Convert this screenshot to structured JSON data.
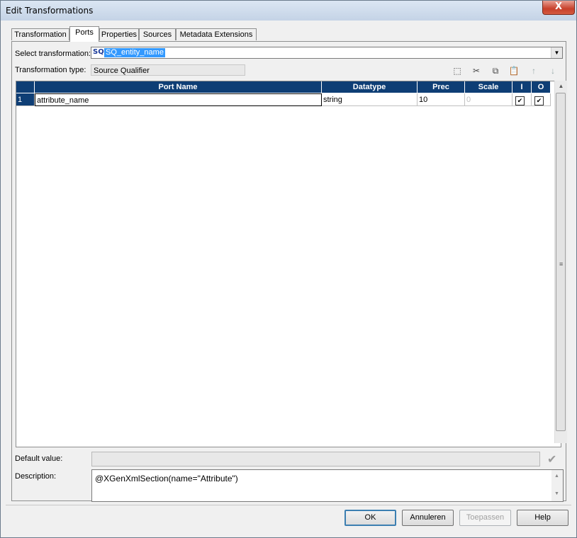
{
  "window": {
    "title": "Edit Transformations",
    "close_glyph": "X"
  },
  "tabs": [
    {
      "label": "Transformation",
      "active": false
    },
    {
      "label": "Ports",
      "active": true
    },
    {
      "label": "Properties",
      "active": false
    },
    {
      "label": "Sources",
      "active": false
    },
    {
      "label": "Metadata Extensions",
      "active": false
    }
  ],
  "select_transformation": {
    "label": "Select transformation:",
    "icon": "SQ",
    "value": "SQ_entity_name"
  },
  "transformation_type": {
    "label": "Transformation type:",
    "value": "Source Qualifier"
  },
  "toolbar": [
    {
      "name": "new-port-icon",
      "glyph": "⬚",
      "enabled": true
    },
    {
      "name": "cut-icon",
      "glyph": "✂",
      "enabled": true
    },
    {
      "name": "copy-icon",
      "glyph": "⧉",
      "enabled": true
    },
    {
      "name": "paste-icon",
      "glyph": "📋",
      "enabled": false
    },
    {
      "name": "move-up-icon",
      "glyph": "↑",
      "enabled": false
    },
    {
      "name": "move-down-icon",
      "glyph": "↓",
      "enabled": false
    }
  ],
  "grid": {
    "columns": [
      "Port Name",
      "Datatype",
      "Prec",
      "Scale",
      "I",
      "O"
    ],
    "rows": [
      {
        "num": "1",
        "port_name": "attribute_name",
        "datatype": "string",
        "prec": "10",
        "scale": "0",
        "input": true,
        "output": true
      }
    ]
  },
  "default_value": {
    "label": "Default value:",
    "value": ""
  },
  "description": {
    "label": "Description:",
    "value": "@XGenXmlSection(name=\"Attribute\")"
  },
  "buttons": {
    "ok": "OK",
    "cancel": "Annuleren",
    "apply": "Toepassen",
    "help": "Help"
  },
  "colors": {
    "grid_header": "#0e3e75",
    "selection": "#3399ff"
  }
}
